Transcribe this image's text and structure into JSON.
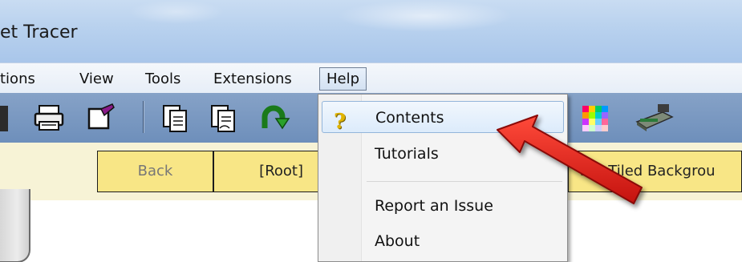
{
  "window": {
    "title": "et Tracer"
  },
  "menubar": {
    "items": [
      {
        "label": "tions"
      },
      {
        "label": "View"
      },
      {
        "label": "Tools"
      },
      {
        "label": "Extensions"
      },
      {
        "label": "Help"
      }
    ]
  },
  "toolbar": {
    "icons": [
      "save-icon",
      "print-icon",
      "edit-icon",
      "copy-icon",
      "paste-icon",
      "undo-icon",
      "palette-icon",
      "device-icon"
    ]
  },
  "navstrip": {
    "back_label": "Back",
    "root_label": "[Root]",
    "tiled_label": "Set Tiled Backgrou"
  },
  "help_menu": {
    "items": [
      {
        "label": "Contents",
        "icon": "help-question-icon"
      },
      {
        "label": "Tutorials"
      },
      {
        "label": "Report an Issue"
      },
      {
        "label": "About"
      }
    ]
  },
  "colors": {
    "annotation_arrow": "#e0231b",
    "menu_hover": "#dcebfb",
    "nav_button": "#f8e686"
  }
}
